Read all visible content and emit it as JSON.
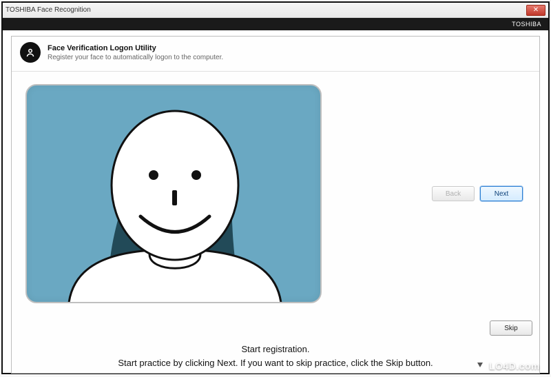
{
  "window": {
    "title": "TOSHIBA Face Recognition",
    "close_symbol": "✕",
    "brand": "TOSHIBA"
  },
  "header": {
    "title": "Face Verification Logon Utility",
    "subtitle": "Register your face to automatically logon to the computer."
  },
  "buttons": {
    "back": "Back",
    "next": "Next",
    "skip": "Skip"
  },
  "instructions": {
    "line1": "Start registration.",
    "line2": "Start practice by clicking Next. If you want to skip practice, click the Skip button."
  },
  "watermark": {
    "text": "LO4D.com"
  }
}
